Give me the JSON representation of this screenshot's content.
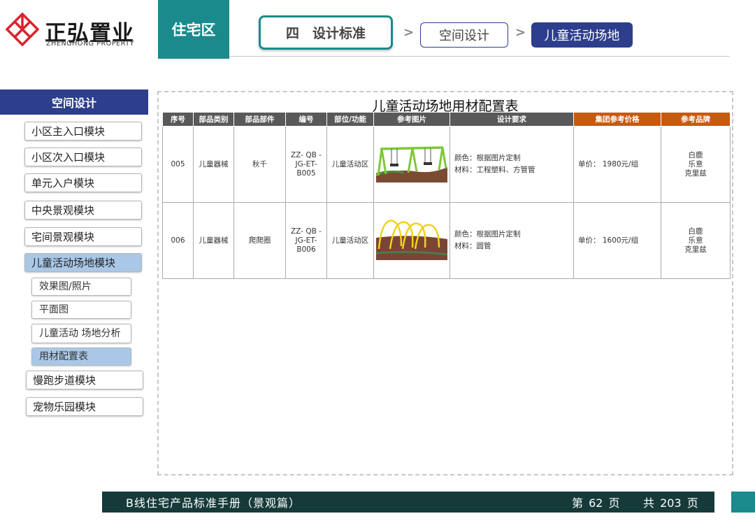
{
  "brand": {
    "name_cn": "正弘置业",
    "name_en": "ZHENGHONG PROPERTY"
  },
  "header": {
    "zone": "住宅区",
    "breadcrumb": [
      "四　设计标准",
      "空间设计",
      "儿童活动场地"
    ]
  },
  "sidebar": {
    "title": "空间设计",
    "items": [
      "小区主入口模块",
      "小区次入口模块",
      "单元入户模块",
      "中央景观模块",
      "宅间景观模块",
      "儿童活动场地模块"
    ],
    "sub_items": [
      "效果图/照片",
      "平面图",
      "儿童活动 场地分析",
      "用材配置表"
    ],
    "items_after": [
      "慢跑步道模块",
      "宠物乐园模块"
    ]
  },
  "table": {
    "title": "儿童活动场地用材配置表",
    "headers": [
      "序号",
      "部品类别",
      "部品部件",
      "编号",
      "部位/功能",
      "参考图片",
      "设计要求",
      "集团参考价格",
      "参考品牌"
    ],
    "rows": [
      {
        "no": "005",
        "category": "儿童器械",
        "part": "秋千",
        "code": "ZZ- QB -JG-ET-B005",
        "location": "儿童活动区",
        "image": "swing-set-image",
        "req_color": "颜色：根据图片定制",
        "req_material": "材料：工程塑料、方管管",
        "price": "单价： 1980元/组",
        "brands": [
          "白鹿",
          "乐意",
          "克里兹"
        ]
      },
      {
        "no": "006",
        "category": "儿童器械",
        "part": "爬爬圈",
        "code": "ZZ- QB -JG-ET-B006",
        "location": "儿童活动区",
        "image": "crawl-hoops-image",
        "req_color": "颜色：根据图片定制",
        "req_material": "材料：圆管",
        "price": "单价： 1600元/组",
        "brands": [
          "白鹿",
          "乐意",
          "克里兹"
        ]
      }
    ]
  },
  "footer": {
    "title": "B线住宅产品标准手册（景观篇）",
    "page": "第 62 页",
    "total": "共 203 页"
  },
  "colors": {
    "teal": "#1a8a8c",
    "navy": "#2c3e8c",
    "orange": "#c55a11",
    "header_gray": "#595959",
    "footer_dark": "#163a3a",
    "active_blue": "#a9c8e8"
  }
}
